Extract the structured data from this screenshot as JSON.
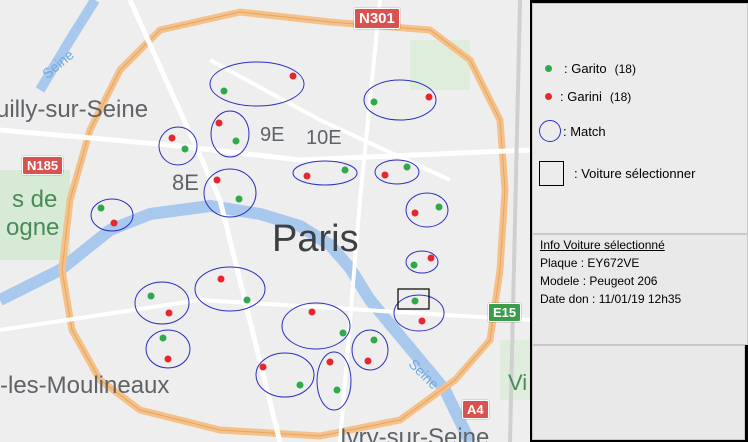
{
  "map": {
    "city_label": "Paris",
    "district_labels": [
      "9E",
      "10E",
      "8E"
    ],
    "place_labels": {
      "issy": "uilly-sur-Seine",
      "moulineaux": "-les-Moulineaux",
      "ivry": "Ivry-sur-Seine",
      "de": "s de",
      "ogne": "ogne",
      "vi": "Vi"
    },
    "river_labels": [
      "Seine",
      "Seine"
    ],
    "road_badges": {
      "n301": "N301",
      "n185": "N185",
      "e15": "E15",
      "a4": "A4"
    },
    "colors": {
      "garito_dot": "#2eaa4b",
      "garini_dot": "#e6272e",
      "match_ellipse": "#2b2fbf",
      "ring_road": "#f2b36b"
    },
    "match_groups": 18,
    "selected_marker": "selected-vehicle-square"
  },
  "legend": {
    "garito_label": ": Garito",
    "garito_count": "(18)",
    "garini_label": ": Garini",
    "garini_count": "(18)",
    "match_label": ": Match",
    "selected_label": ": Voiture sélectionner"
  },
  "info": {
    "title": "Info Voiture sélectionné",
    "plate": "Plaque : EY672VE",
    "model": "Modele : Peugeot 206",
    "date": "Date don : 11/01/19 12h35"
  }
}
